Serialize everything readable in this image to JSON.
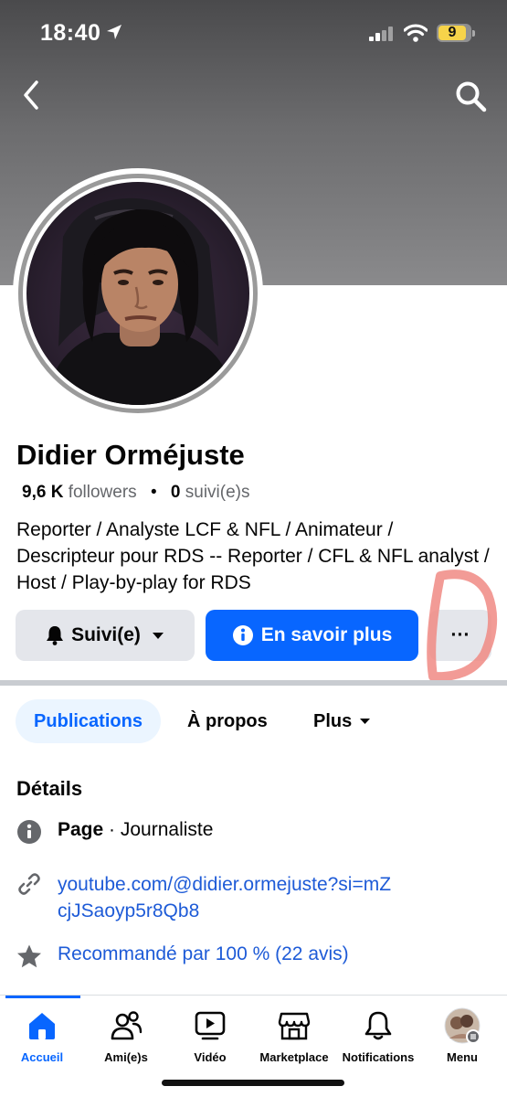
{
  "status_bar": {
    "time": "18:40",
    "battery": "9"
  },
  "profile": {
    "name": "Didier Orméjuste",
    "followers_count": "9,6 K",
    "followers_label": "followers",
    "following_count": "0",
    "following_label": "suivi(e)s",
    "bio": "Reporter / Analyste LCF & NFL / Animateur / Descripteur pour RDS -- Reporter / CFL & NFL analyst / Host / Play-by-play for RDS"
  },
  "actions": {
    "follow_label": "Suivi(e)",
    "learn_more_label": "En savoir plus",
    "more_label": "···"
  },
  "tabs": [
    {
      "label": "Publications",
      "active": true
    },
    {
      "label": "À propos",
      "active": false
    },
    {
      "label": "Plus",
      "active": false
    }
  ],
  "details": {
    "title": "Détails",
    "page_bold": "Page",
    "page_category": " · Journaliste",
    "link": "youtube.com/@didier.ormejuste?si=mZcjJSaoyp5r8Qb8",
    "recommendation": "Recommandé par 100 % (22 avis)"
  },
  "bottom_nav": [
    {
      "label": "Accueil",
      "icon": "home-icon",
      "active": true
    },
    {
      "label": "Ami(e)s",
      "icon": "friends-icon",
      "active": false
    },
    {
      "label": "Vidéo",
      "icon": "video-icon",
      "active": false
    },
    {
      "label": "Marketplace",
      "icon": "marketplace-icon",
      "active": false
    },
    {
      "label": "Notifications",
      "icon": "bell-icon",
      "active": false
    },
    {
      "label": "Menu",
      "icon": "avatar-icon",
      "active": false
    }
  ],
  "colors": {
    "accent": "#0866ff",
    "link": "#1e5bd7",
    "button_gray": "#e4e6eb",
    "annotation": "#f08a84"
  }
}
